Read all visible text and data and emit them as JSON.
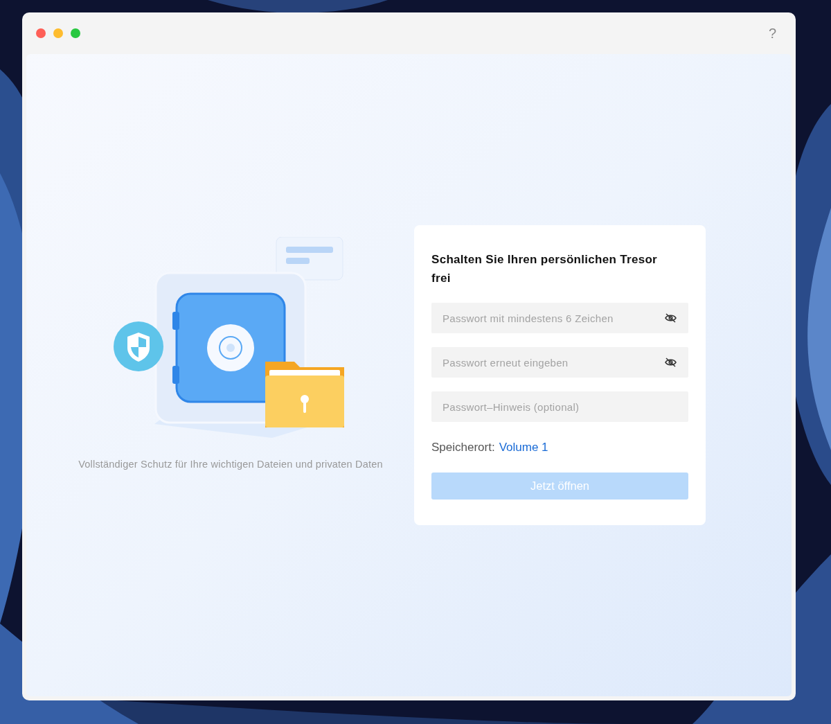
{
  "window": {
    "help": "?"
  },
  "illustration": {
    "caption": "Vollständiger Schutz für Ihre wichtigen Dateien und privaten Daten"
  },
  "form": {
    "title": "Schalten Sie Ihren persönlichen Tresor frei",
    "fields": [
      {
        "kind": "password",
        "placeholder": "Passwort mit mindestens 6 Zeichen"
      },
      {
        "kind": "password",
        "placeholder": "Passwort erneut eingeben"
      },
      {
        "kind": "text",
        "placeholder": "Passwort–Hinweis (optional)"
      }
    ],
    "location": {
      "label": "Speicherort:",
      "value": "Volume 1"
    },
    "submit": {
      "label": "Jetzt öffnen",
      "disabled": true
    }
  }
}
